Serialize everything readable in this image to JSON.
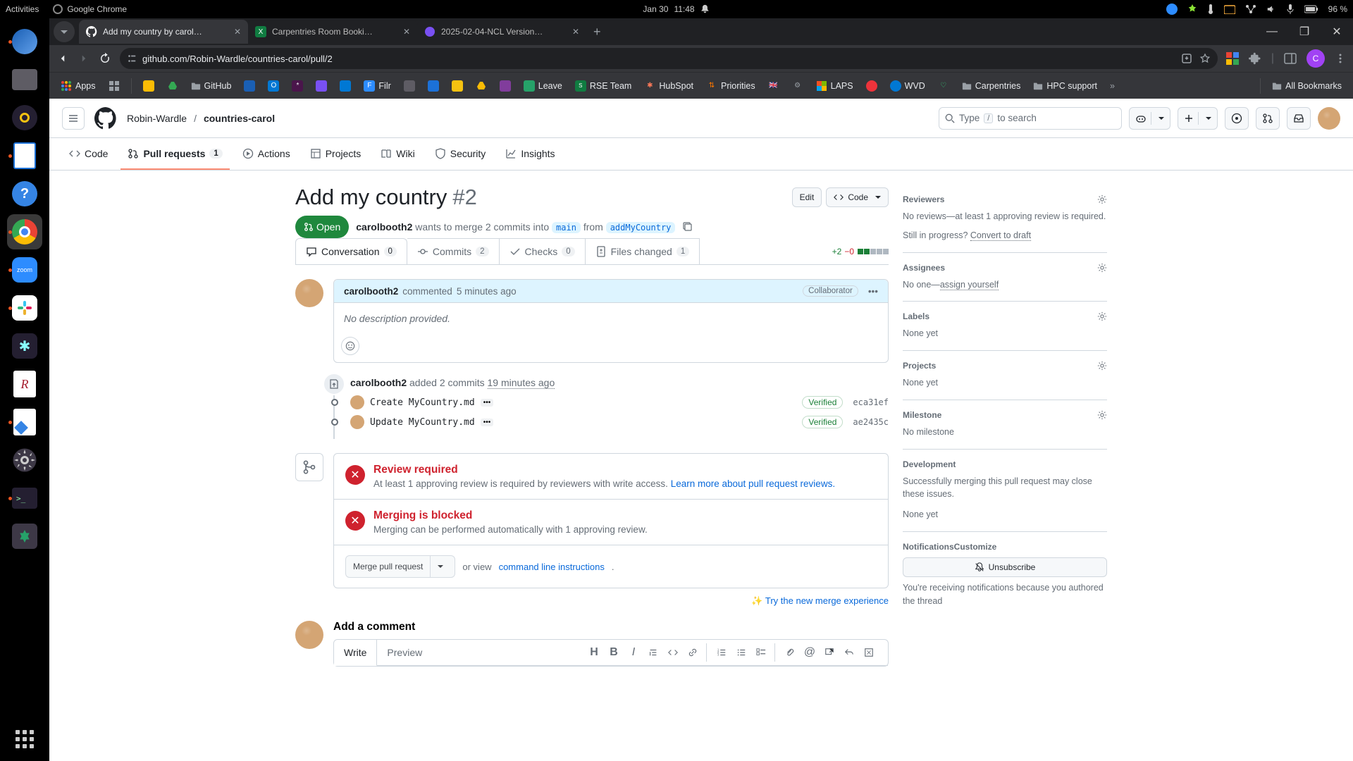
{
  "gnome": {
    "activities": "Activities",
    "app_name": "Google Chrome",
    "date": "Jan 30",
    "time": "11:48",
    "battery": "96 %"
  },
  "tabs": {
    "t1": "Add my country by carol…",
    "t2": "Carpentries Room Booki…",
    "t3": "2025-02-04-NCL Version…"
  },
  "url": "github.com/Robin-Wardle/countries-carol/pull/2",
  "bookmarks": {
    "apps": "Apps",
    "github": "GitHub",
    "filr": "Filr",
    "leave": "Leave",
    "rse": "RSE Team",
    "hubspot": "HubSpot",
    "priorities": "Priorities",
    "laps": "LAPS",
    "wvd": "WVD",
    "carp": "Carpentries",
    "hpc": "HPC support",
    "all": "All Bookmarks"
  },
  "repo": {
    "owner": "Robin-Wardle",
    "name": "countries-carol",
    "search": "Type",
    "search_kbd": "/",
    "search_after": "to search",
    "tabs": {
      "code": "Code",
      "pr": "Pull requests",
      "pr_count": "1",
      "actions": "Actions",
      "projects": "Projects",
      "wiki": "Wiki",
      "security": "Security",
      "insights": "Insights"
    }
  },
  "pr": {
    "title": "Add my country",
    "number": "#2",
    "edit": "Edit",
    "code_btn": "Code",
    "state": "Open",
    "author": "carolbooth2",
    "merge_text": "wants to merge 2 commits into",
    "base": "main",
    "from": "from",
    "head": "addMyCountry",
    "tabs": {
      "conv": "Conversation",
      "conv_c": "0",
      "commits": "Commits",
      "commits_c": "2",
      "checks": "Checks",
      "checks_c": "0",
      "files": "Files changed",
      "files_c": "1"
    },
    "diff": {
      "add": "+2",
      "del": "−0"
    }
  },
  "comment": {
    "author": "carolbooth2",
    "verb": "commented",
    "when": "5 minutes ago",
    "badge": "Collaborator",
    "body": "No description provided."
  },
  "events": {
    "push_author": "carolbooth2",
    "push_verb": "added 2 commits",
    "push_when": "19 minutes ago",
    "c1_msg": "Create MyCountry.md",
    "c1_sha": "eca31ef",
    "c2_msg": "Update MyCountry.md",
    "c2_sha": "ae2435c",
    "verified": "Verified"
  },
  "merge": {
    "review_h": "Review required",
    "review_t": "At least 1 approving review is required by reviewers with write access.",
    "review_l": "Learn more about pull request reviews.",
    "block_h": "Merging is blocked",
    "block_t": "Merging can be performed automatically with 1 approving review.",
    "btn": "Merge pull request",
    "or": "or view",
    "cli": "command line instructions",
    "dot": ".",
    "trynew": "Try the new merge experience"
  },
  "editor": {
    "title": "Add a comment",
    "write": "Write",
    "preview": "Preview"
  },
  "sidebar": {
    "reviewers": "Reviewers",
    "reviewers_t": "No reviews—at least 1 approving review is required.",
    "still": "Still in progress?",
    "draft": "Convert to draft",
    "assignees": "Assignees",
    "assignees_t": "No one—",
    "assign_self": "assign yourself",
    "labels": "Labels",
    "labels_t": "None yet",
    "projects": "Projects",
    "projects_t": "None yet",
    "milestone": "Milestone",
    "milestone_t": "No milestone",
    "dev": "Development",
    "dev_t": "Successfully merging this pull request may close these issues.",
    "dev_none": "None yet",
    "notif": "Notifications",
    "customize": "Customize",
    "unsub": "Unsubscribe",
    "notif_t": "You're receiving notifications because you authored the thread"
  },
  "profile_letter": "C"
}
